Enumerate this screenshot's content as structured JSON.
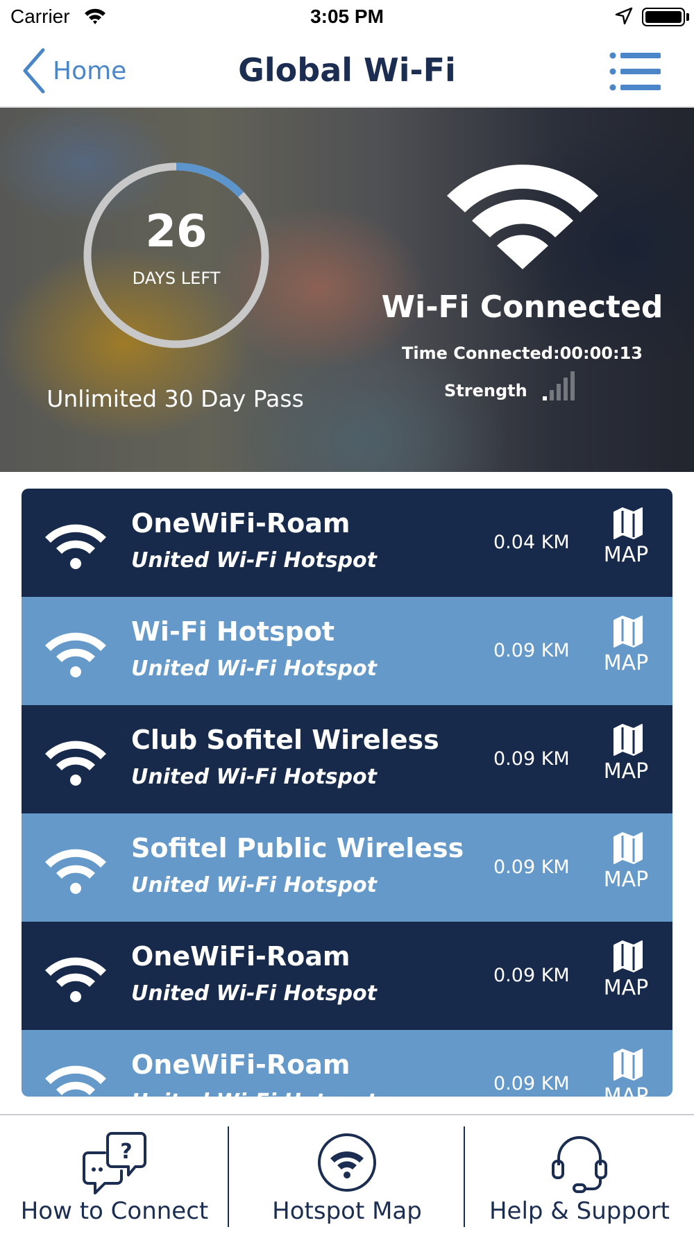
{
  "status_bar": {
    "carrier": "Carrier",
    "time": "3:05 PM",
    "icons": [
      "wifi-signal-icon",
      "location-arrow-icon",
      "battery-icon"
    ]
  },
  "nav": {
    "back_label": "Home",
    "title": "Global Wi-Fi",
    "back_icon": "chevron-left-icon",
    "menu_icon": "list-menu-icon"
  },
  "pass": {
    "days_number": "26",
    "days_label": "DAYS LEFT",
    "days_progress_fraction": 0.13,
    "name": "Unlimited 30 Day Pass"
  },
  "connection": {
    "status": "Wi-Fi Connected",
    "time_connected": "Time Connected:00:00:13",
    "strength_label": "Strength",
    "strength_level": 1,
    "strength_max": 5
  },
  "hotspots": [
    {
      "name": "OneWiFi-Roam",
      "provider": "United Wi-Fi Hotspot",
      "distance": "0.04 KM",
      "map_label": "MAP",
      "theme": "dark"
    },
    {
      "name": "Wi-Fi Hotspot",
      "provider": "United Wi-Fi Hotspot",
      "distance": "0.09 KM",
      "map_label": "MAP",
      "theme": "light"
    },
    {
      "name": "Club Sofitel Wireless",
      "provider": "United Wi-Fi Hotspot",
      "distance": "0.09 KM",
      "map_label": "MAP",
      "theme": "dark"
    },
    {
      "name": "Sofitel Public Wireless",
      "provider": "United Wi-Fi Hotspot",
      "distance": "0.09 KM",
      "map_label": "MAP",
      "theme": "light"
    },
    {
      "name": "OneWiFi-Roam",
      "provider": "United Wi-Fi Hotspot",
      "distance": "0.09 KM",
      "map_label": "MAP",
      "theme": "dark"
    },
    {
      "name": "OneWiFi-Roam",
      "provider": "United Wi-Fi Hotspot",
      "distance": "0.09 KM",
      "map_label": "MAP",
      "theme": "light"
    }
  ],
  "tabs": [
    {
      "label": "How to Connect",
      "icon": "chat-question-icon"
    },
    {
      "label": "Hotspot Map",
      "icon": "wifi-circle-icon"
    },
    {
      "label": "Help & Support",
      "icon": "headset-icon"
    }
  ],
  "colors": {
    "navy": "#1c2d52",
    "row_dark": "#172a4b",
    "row_light": "#6499c9",
    "accent_blue": "#4a86c8",
    "ring_progress": "#5b95cc"
  }
}
